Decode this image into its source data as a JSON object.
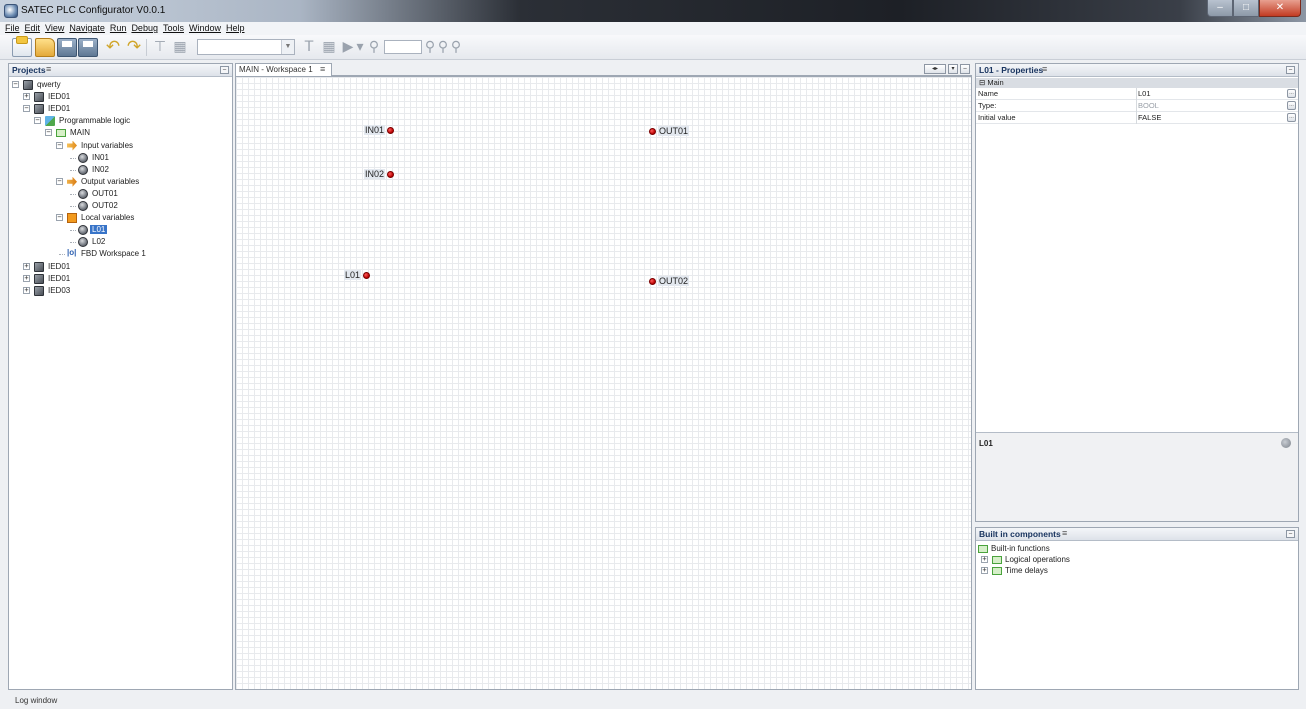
{
  "window": {
    "title": "SATEC PLC Configurator V0.0.1",
    "minimize": "–",
    "maximize": "□",
    "close": "✕"
  },
  "menu": [
    "File",
    "Edit",
    "View",
    "Navigate",
    "Run",
    "Debug",
    "Tools",
    "Window",
    "Help"
  ],
  "projects": {
    "title": "Projects",
    "tab_icon": "≡",
    "min_icon": "–",
    "tree": [
      {
        "label": "qwerty",
        "depth": 0,
        "icon": "ied",
        "expander": "−"
      },
      {
        "label": "IED01",
        "depth": 1,
        "icon": "ied",
        "expander": "+"
      },
      {
        "label": "IED01",
        "depth": 1,
        "icon": "ied",
        "expander": "−"
      },
      {
        "label": "Programmable logic",
        "depth": 2,
        "icon": "prog",
        "expander": "−"
      },
      {
        "label": "MAIN",
        "depth": 3,
        "icon": "main",
        "expander": "−"
      },
      {
        "label": "Input variables",
        "depth": 4,
        "icon": "in",
        "expander": "−"
      },
      {
        "label": "IN01",
        "depth": 5,
        "icon": "var",
        "expander": ""
      },
      {
        "label": "IN02",
        "depth": 5,
        "icon": "var",
        "expander": ""
      },
      {
        "label": "Output variables",
        "depth": 4,
        "icon": "out",
        "expander": "−"
      },
      {
        "label": "OUT01",
        "depth": 5,
        "icon": "var",
        "expander": ""
      },
      {
        "label": "OUT02",
        "depth": 5,
        "icon": "var",
        "expander": ""
      },
      {
        "label": "Local variables",
        "depth": 4,
        "icon": "local",
        "expander": "−"
      },
      {
        "label": "L01",
        "depth": 5,
        "icon": "var",
        "expander": "",
        "selected": true
      },
      {
        "label": "L02",
        "depth": 5,
        "icon": "var",
        "expander": ""
      },
      {
        "label": "FBD Workspace 1",
        "depth": 4,
        "icon": "fbd",
        "expander": ""
      },
      {
        "label": "IED01",
        "depth": 1,
        "icon": "ied",
        "expander": "+"
      },
      {
        "label": "IED01",
        "depth": 1,
        "icon": "ied",
        "expander": "+"
      },
      {
        "label": "IED03",
        "depth": 1,
        "icon": "ied",
        "expander": "+"
      }
    ]
  },
  "workspace": {
    "tab_label": "MAIN - Workspace 1",
    "tab_icon": "≡",
    "controls": [
      "◂▸",
      "▾",
      "–"
    ],
    "inputs": [
      "IN01",
      "IN02",
      "L01"
    ],
    "outputs": [
      "OUT01",
      "OUT02"
    ]
  },
  "properties": {
    "title": "L01 - Properties",
    "tab_icon": "≡",
    "section": "⊟ Main",
    "rows": [
      {
        "name": "Name",
        "value": "L01",
        "dim": false
      },
      {
        "name": "Type:",
        "value": "BOOL",
        "dim": true
      },
      {
        "name": "Initial value",
        "value": "FALSE",
        "dim": false
      }
    ],
    "row_button": "…",
    "description_title": "L01"
  },
  "builtin": {
    "title": "Built in components",
    "tab_icon": "≡",
    "items": [
      {
        "label": "Built-in functions",
        "expander": ""
      },
      {
        "label": "Logical operations",
        "expander": "+"
      },
      {
        "label": "Time delays",
        "expander": "+"
      }
    ]
  },
  "status": {
    "log_window": "Log window"
  },
  "icons": {
    "new": "new-project-icon",
    "open": "open-folder-icon",
    "save": "save-icon",
    "save_all": "save-all-icon",
    "undo": "undo-icon",
    "redo": "redo-icon",
    "run": "run-icon",
    "zoom": "zoom-icon"
  },
  "colors": {
    "pin": "#c00000",
    "selection": "#3874c8",
    "panel_title": "#1a3560"
  }
}
